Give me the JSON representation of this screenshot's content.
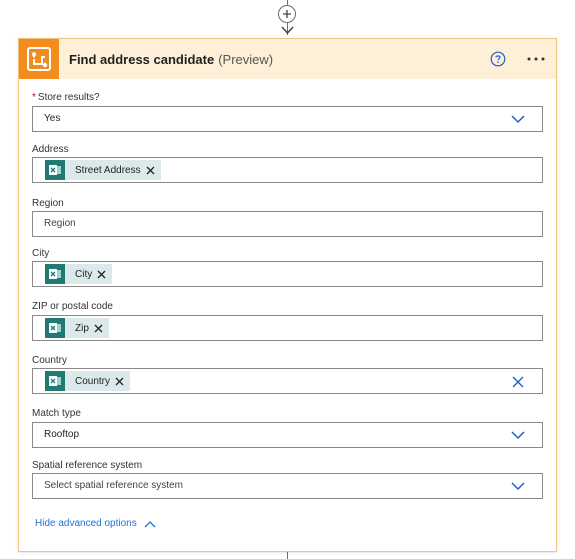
{
  "card": {
    "title": "Find address candidate",
    "title_suffix": "(Preview)",
    "header_color": "#fdefd8",
    "icon_color": "#f28c1e",
    "icon": "map-route-icon"
  },
  "fields": {
    "store_results": {
      "label": "Store results?",
      "required": "*",
      "value": "Yes"
    },
    "address": {
      "label": "Address",
      "token": "Street Address"
    },
    "region": {
      "label": "Region",
      "placeholder": "Region"
    },
    "city": {
      "label": "City",
      "token": "City"
    },
    "zip": {
      "label": "ZIP or postal code",
      "token": "Zip"
    },
    "country": {
      "label": "Country",
      "token": "Country"
    },
    "match_type": {
      "label": "Match type",
      "value": "Rooftop"
    },
    "spatial_ref": {
      "label": "Spatial reference system",
      "placeholder": "Select spatial reference system"
    }
  },
  "advanced": {
    "label": "Hide advanced options"
  },
  "colors": {
    "link": "#1f6fd6",
    "token_bg": "#dce9ea",
    "token_icon": "#1f7a73"
  }
}
